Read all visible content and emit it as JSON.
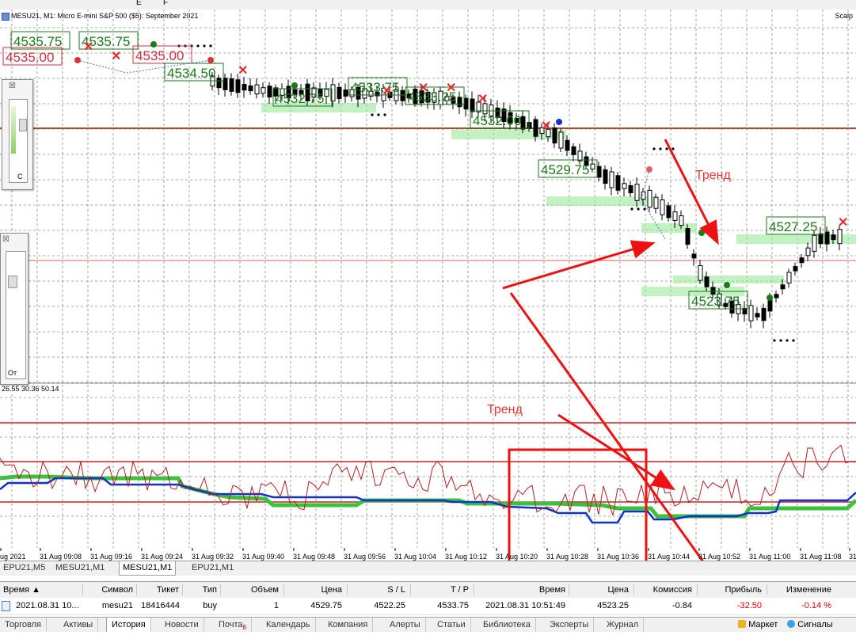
{
  "window": {
    "chart_title": "MESU21, M1:  Micro E-mini S&P 500 ($5): September 2021",
    "ea_label": "Scalp",
    "toolbar_fragment_1": "E",
    "toolbar_fragment_2": "F"
  },
  "indicator": {
    "readout": "26.55 30.36 50.14"
  },
  "annotations": {
    "trend_top": "Тренд",
    "trend_bottom": "Тренд"
  },
  "price_labels": {
    "items": [
      "4535.75",
      "4535.75",
      "4535.00",
      "4535.00",
      "4534.50",
      "4533.25",
      "4533.75",
      "4532.75",
      "4532.00",
      "4529.75",
      "4527.25",
      "4523.75"
    ]
  },
  "time_axis": {
    "labels": [
      "Aug 2021",
      "31 Aug 09:08",
      "31 Aug 09:16",
      "31 Aug 09:24",
      "31 Aug 09:32",
      "31 Aug 09:40",
      "31 Aug 09:48",
      "31 Aug 09:56",
      "31 Aug 10:04",
      "31 Aug 10:12",
      "31 Aug 10:20",
      "31 Aug 10:28",
      "31 Aug 10:36",
      "31 Aug 10:44",
      "31 Aug 10:52",
      "31 Aug 11:00",
      "31 Aug 11:08",
      "31"
    ]
  },
  "chart_tabs": [
    "EPU21,M5",
    "MESU21,M1",
    "MESU21,M1",
    "EPU21,M1"
  ],
  "chart_tabs_active": 2,
  "terminal": {
    "headers": {
      "time": "Время",
      "symbol": "Символ",
      "ticket": "Тикет",
      "type": "Тип",
      "volume": "Объем",
      "price": "Цена",
      "sl": "S / L",
      "tp": "T / P",
      "time2": "Время",
      "price2": "Цена",
      "commission": "Комиссия",
      "profit": "Прибыль",
      "change": "Изменение"
    },
    "row": {
      "time": "2021.08.31 10...",
      "symbol": "mesu21",
      "ticket": "18416444",
      "type": "buy",
      "volume": "1",
      "price": "4529.75",
      "sl": "4522.25",
      "tp": "4533.75",
      "time2": "2021.08.31 10:51:49",
      "price2": "4523.25",
      "commission": "-0.84",
      "profit": "-32.50",
      "change": "-0.14 %"
    }
  },
  "bottom_tabs": [
    "Торговля",
    "Активы",
    "История",
    "Новости",
    "Почта",
    "Календарь",
    "Компания",
    "Алерты",
    "Статьи",
    "Библиотека",
    "Эксперты",
    "Журнал"
  ],
  "bottom_tabs_active": 2,
  "mail_badge": "8",
  "bottom_right": {
    "market": "Маркет",
    "signals": "Сигналы"
  },
  "colors": {
    "grid": "#8c8c8c",
    "resistance_line": "#a0522d",
    "level_line": "#e06060",
    "bull_green": "#1a7a1a",
    "bear_red": "#e03030",
    "zone_green": "#8fe08f",
    "arrow_red": "#ee1111",
    "rsi_line": "#b22222",
    "blue_line": "#1030d0",
    "green_line": "#3cc13c",
    "loss_text": "#e00000"
  }
}
